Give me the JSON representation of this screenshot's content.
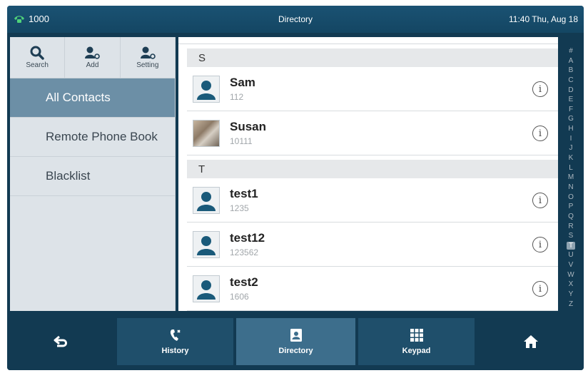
{
  "status": {
    "line_number": "1000",
    "title": "Directory",
    "datetime": "11:40 Thu, Aug 18",
    "phone_icon": "phone-icon",
    "accent_color": "#4fd27a"
  },
  "toolbar": {
    "search_label": "Search",
    "add_label": "Add",
    "setting_label": "Setting"
  },
  "sidebar": {
    "items": [
      {
        "label": "All Contacts",
        "active": true
      },
      {
        "label": "Remote Phone Book",
        "active": false
      },
      {
        "label": "Blacklist",
        "active": false
      }
    ]
  },
  "groups": [
    {
      "letter": "S"
    },
    {
      "letter": "T"
    }
  ],
  "contacts": [
    {
      "name": "Sam",
      "number": "112",
      "avatar": "person-icon"
    },
    {
      "name": "Susan",
      "number": "10111",
      "avatar": "photo"
    },
    {
      "name": "test1",
      "number": "1235",
      "avatar": "person-icon"
    },
    {
      "name": "test12",
      "number": "123562",
      "avatar": "person-icon"
    },
    {
      "name": "test2",
      "number": "1606",
      "avatar": "person-icon"
    }
  ],
  "alphabet": [
    "#",
    "A",
    "B",
    "C",
    "D",
    "E",
    "F",
    "G",
    "H",
    "I",
    "J",
    "K",
    "L",
    "M",
    "N",
    "O",
    "P",
    "Q",
    "R",
    "S",
    "T",
    "U",
    "V",
    "W",
    "X",
    "Y",
    "Z"
  ],
  "alphabet_current": "T",
  "bottom_nav": {
    "history_label": "History",
    "directory_label": "Directory",
    "keypad_label": "Keypad"
  },
  "colors": {
    "background": "#123a52",
    "active_menu": "#6c8fa6",
    "icon_blue": "#1a5a7a"
  }
}
